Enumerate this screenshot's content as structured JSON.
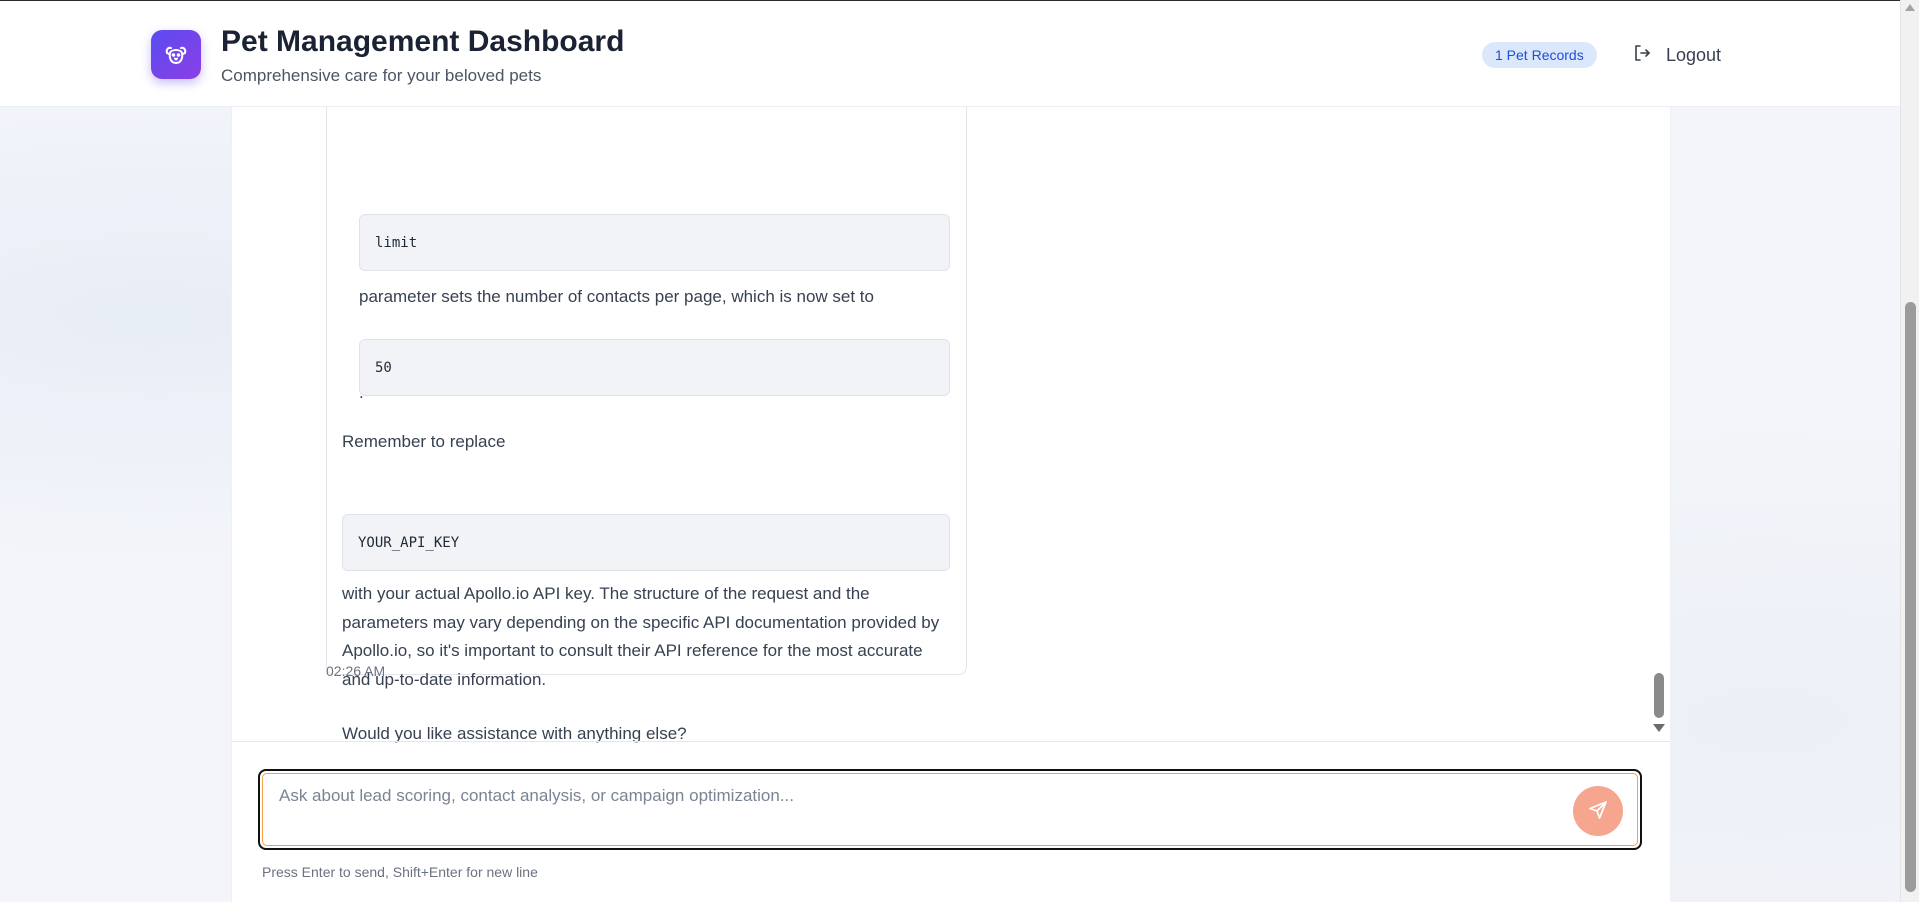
{
  "header": {
    "title": "Pet Management Dashboard",
    "subtitle": "Comprehensive care for your beloved pets",
    "records_badge": "1 Pet Records",
    "logout_label": "Logout",
    "logo_icon": "paw-icon",
    "logout_icon": "logout-icon"
  },
  "message": {
    "code_limit": "limit",
    "text_limit": "parameter sets the number of contacts per page, which is now set to",
    "code_50": "50",
    "text_period": ".",
    "text_replace": "Remember to replace",
    "code_api_key": "YOUR_API_KEY",
    "text_body": "with your actual Apollo.io API key. The structure of the request and the parameters may vary depending on the specific API documentation provided by Apollo.io, so it's important to consult their API reference for the most accurate and up-to-date information.",
    "text_closing": "Would you like assistance with anything else?",
    "timestamp": "02:26 AM"
  },
  "composer": {
    "placeholder": "Ask about lead scoring, contact analysis, or campaign optimization...",
    "send_icon": "send-icon",
    "hint": "Press Enter to send, Shift+Enter for new line"
  },
  "colors": {
    "brand_gradient_start": "#5a4cf0",
    "brand_gradient_end": "#8b3fe6",
    "badge_bg": "#dbe8fb",
    "badge_text": "#1d4ed8",
    "send_button": "#f6a58e",
    "input_focus": "#f5a04a"
  }
}
